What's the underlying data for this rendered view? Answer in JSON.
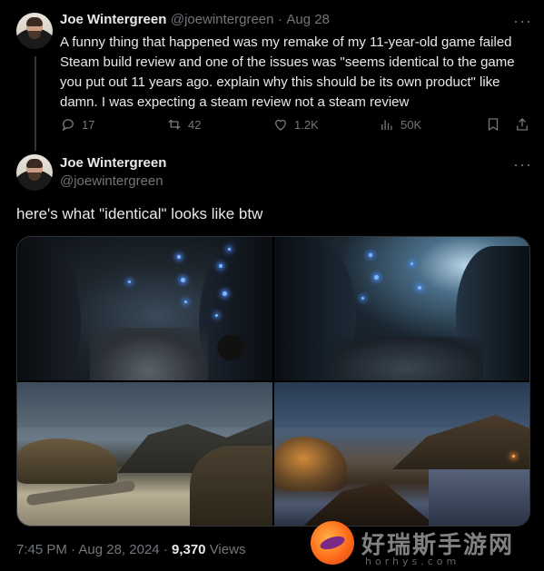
{
  "tweet1": {
    "author_name": "Joe Wintergreen",
    "handle": "@joewintergreen",
    "separator": "·",
    "date": "Aug 28",
    "more": "···",
    "text": "A funny thing that happened was my remake of my 11-year-old game failed Steam build review and one of the issues was \"seems identical to the game you put out 11 years ago. explain why this should be its own product\" like damn. I was expecting a steam review not a steam review",
    "replies": "17",
    "reposts": "42",
    "likes": "1.2K",
    "views": "50K"
  },
  "tweet2": {
    "author_name": "Joe Wintergreen",
    "handle": "@joewintergreen",
    "more": "···",
    "text": "here's what \"identical\" looks like btw",
    "time": "7:45 PM",
    "date": "Aug 28, 2024",
    "separator": "·",
    "views_count": "9,370",
    "views_label": "Views"
  },
  "watermark": {
    "text": "好瑞斯手游网",
    "sub": "horhys.com"
  },
  "colors": {
    "background": "#000000",
    "text": "#e7e9ea",
    "muted": "#71767b",
    "border": "#2f3336"
  }
}
